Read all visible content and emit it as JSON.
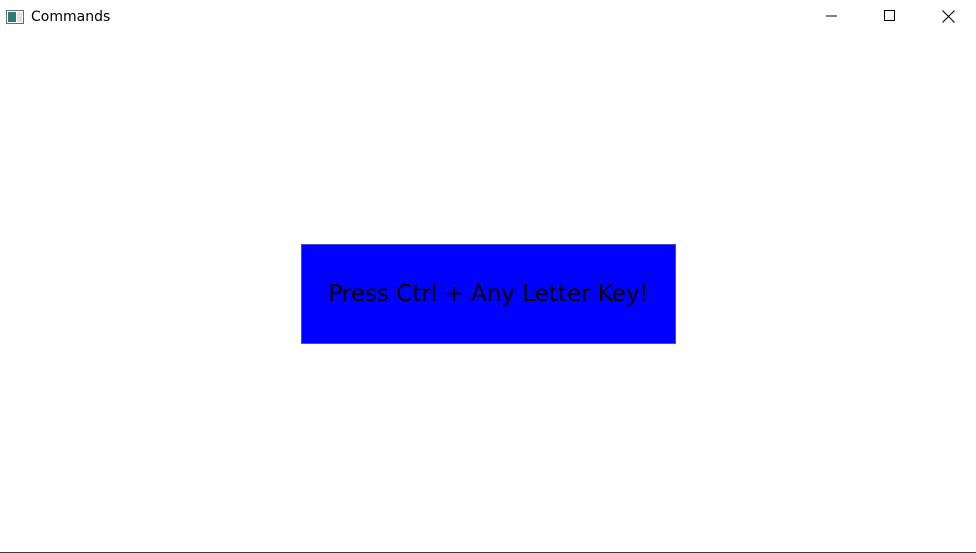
{
  "window": {
    "title": "Commands",
    "icon": "window-app-icon"
  },
  "title_controls": {
    "minimize_icon": "minimize-icon",
    "maximize_icon": "maximize-icon",
    "close_icon": "close-icon"
  },
  "main": {
    "prompt_text": "Press Ctrl + Any Letter Key!",
    "box_color": "#0000ff"
  }
}
